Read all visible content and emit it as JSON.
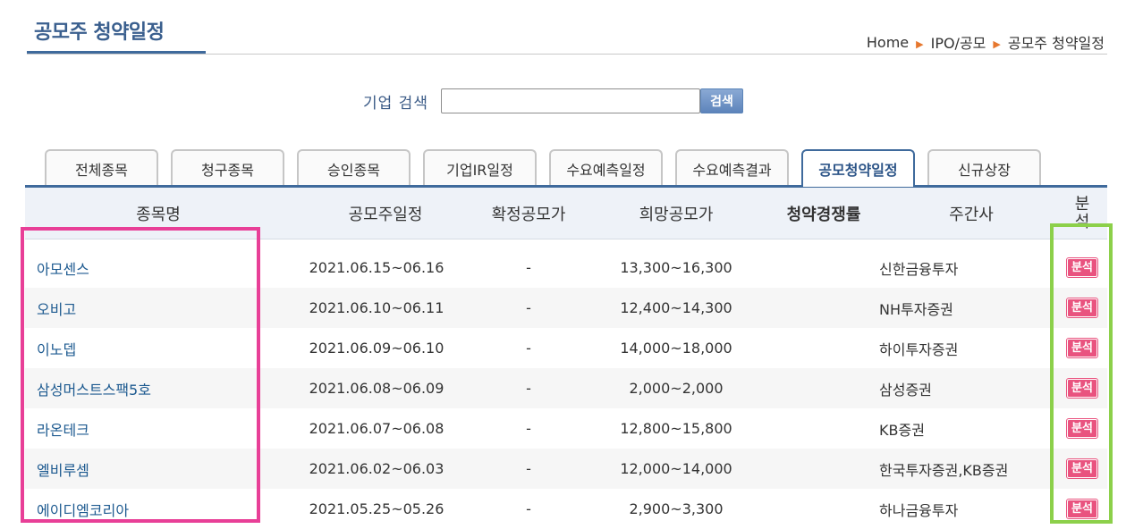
{
  "page": {
    "title": "공모주 청약일정",
    "breadcrumb": [
      "Home",
      "IPO/공모",
      "공모주 청약일정"
    ]
  },
  "search": {
    "label": "기업 검색",
    "value": "",
    "placeholder": "",
    "button_label": "검색"
  },
  "tabs": [
    {
      "label": "전체종목",
      "active": false
    },
    {
      "label": "청구종목",
      "active": false
    },
    {
      "label": "승인종목",
      "active": false
    },
    {
      "label": "기업IR일정",
      "active": false
    },
    {
      "label": "수요예측일정",
      "active": false
    },
    {
      "label": "수요예측결과",
      "active": false
    },
    {
      "label": "공모청약일정",
      "active": true
    },
    {
      "label": "신규상장",
      "active": false
    }
  ],
  "table": {
    "headers": {
      "name": "종목명",
      "schedule": "공모주일정",
      "fixed_price": "확정공모가",
      "hope_price": "희망공모가",
      "competition": "청약경쟁률",
      "underwriter": "주간사",
      "analysis_1": "분",
      "analysis_2": "석"
    },
    "rows": [
      {
        "name": "아모센스",
        "schedule": "2021.06.15~06.16",
        "fixed_price": "-",
        "hope_price": "13,300~16,300",
        "competition": "",
        "underwriter": "신한금융투자",
        "analysis": "분석"
      },
      {
        "name": "오비고",
        "schedule": "2021.06.10~06.11",
        "fixed_price": "-",
        "hope_price": "12,400~14,300",
        "competition": "",
        "underwriter": "NH투자증권",
        "analysis": "분석"
      },
      {
        "name": "이노뎁",
        "schedule": "2021.06.09~06.10",
        "fixed_price": "-",
        "hope_price": "14,000~18,000",
        "competition": "",
        "underwriter": "하이투자증권",
        "analysis": "분석"
      },
      {
        "name": "삼성머스트스팩5호",
        "schedule": "2021.06.08~06.09",
        "fixed_price": "-",
        "hope_price": "2,000~2,000",
        "competition": "",
        "underwriter": "삼성증권",
        "analysis": "분석"
      },
      {
        "name": "라온테크",
        "schedule": "2021.06.07~06.08",
        "fixed_price": "-",
        "hope_price": "12,800~15,800",
        "competition": "",
        "underwriter": "KB증권",
        "analysis": "분석"
      },
      {
        "name": "엘비루셈",
        "schedule": "2021.06.02~06.03",
        "fixed_price": "-",
        "hope_price": "12,000~14,000",
        "competition": "",
        "underwriter": "한국투자증권,KB증권",
        "analysis": "분석"
      },
      {
        "name": "에이디엠코리아",
        "schedule": "2021.05.25~05.26",
        "fixed_price": "-",
        "hope_price": "2,900~3,300",
        "competition": "",
        "underwriter": "하나금융투자",
        "analysis": "분석"
      }
    ]
  },
  "colors": {
    "accent": "#3f6a9c",
    "badge": "#e9537f",
    "highlight_pink": "#e83f97",
    "highlight_green": "#8cd04a"
  }
}
